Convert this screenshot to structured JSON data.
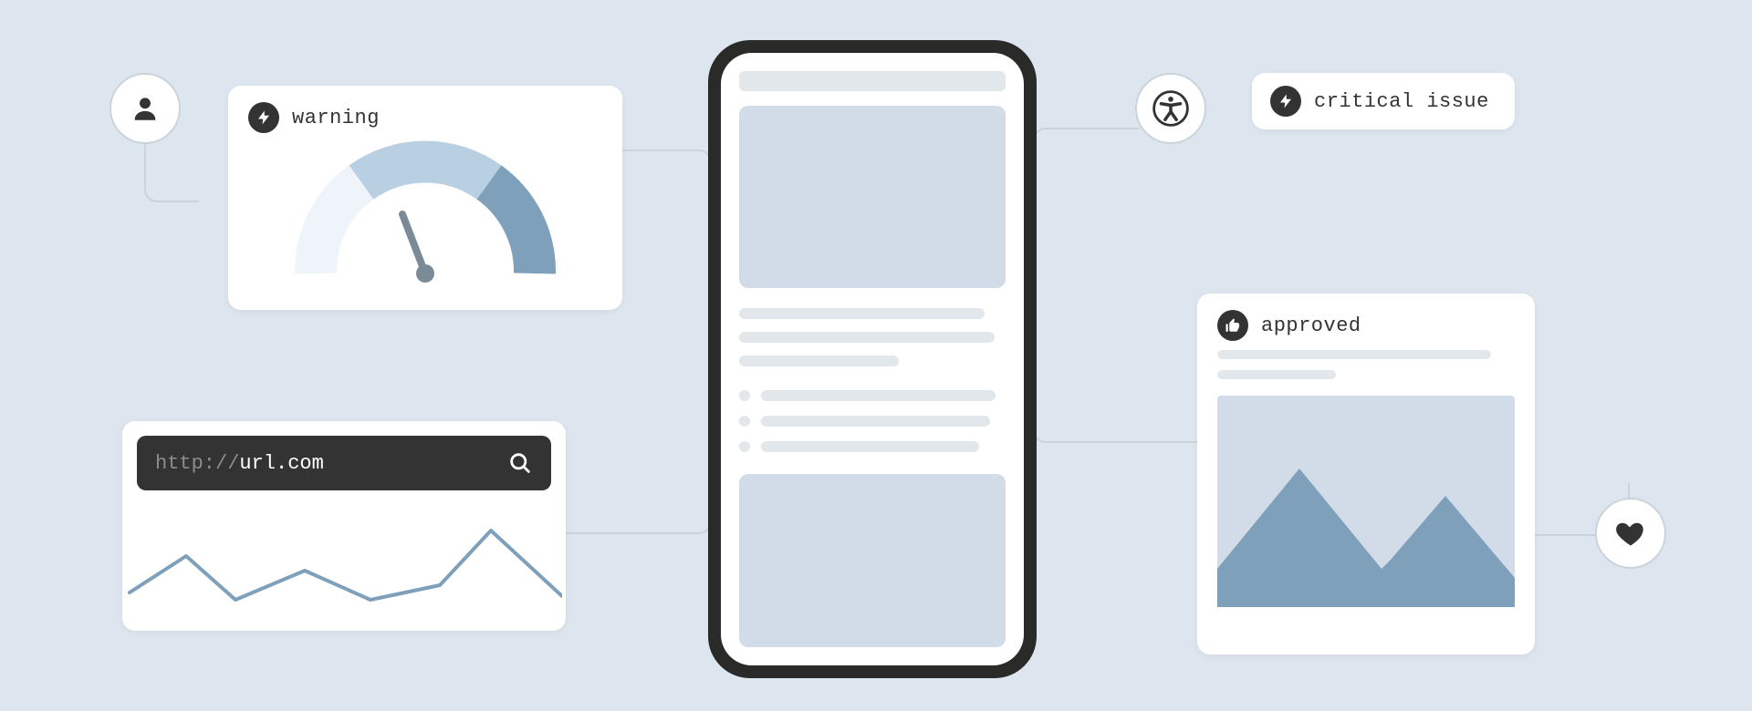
{
  "warning_card": {
    "label": "warning"
  },
  "critical_card": {
    "label": "critical issue"
  },
  "approved_card": {
    "label": "approved"
  },
  "url_card": {
    "url_prefix": "http://",
    "url_host": "url.com"
  },
  "icons": {
    "user": "user-icon",
    "accessibility": "accessibility-icon",
    "heart": "heart-icon",
    "bolt": "bolt-icon",
    "thumbs_up": "thumbs-up-icon",
    "search": "search-icon"
  }
}
